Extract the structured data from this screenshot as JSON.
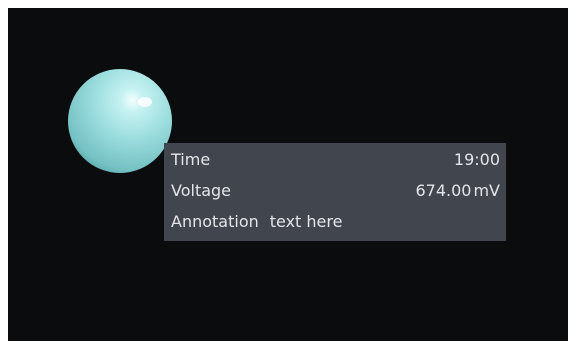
{
  "tooltip": {
    "time_label": "Time",
    "time_value": "19:00",
    "voltage_label": "Voltage",
    "voltage_value": "674.00",
    "voltage_unit": "mV",
    "annotation_label": "Annotation",
    "annotation_text": "text here"
  },
  "colors": {
    "viewport_background": "#0b0c0e",
    "sphere": "#9fdfe0",
    "tooltip_background": "#41454d",
    "tooltip_text": "#e3e5ea"
  },
  "icons": {
    "marker": "sphere-marker-icon"
  }
}
